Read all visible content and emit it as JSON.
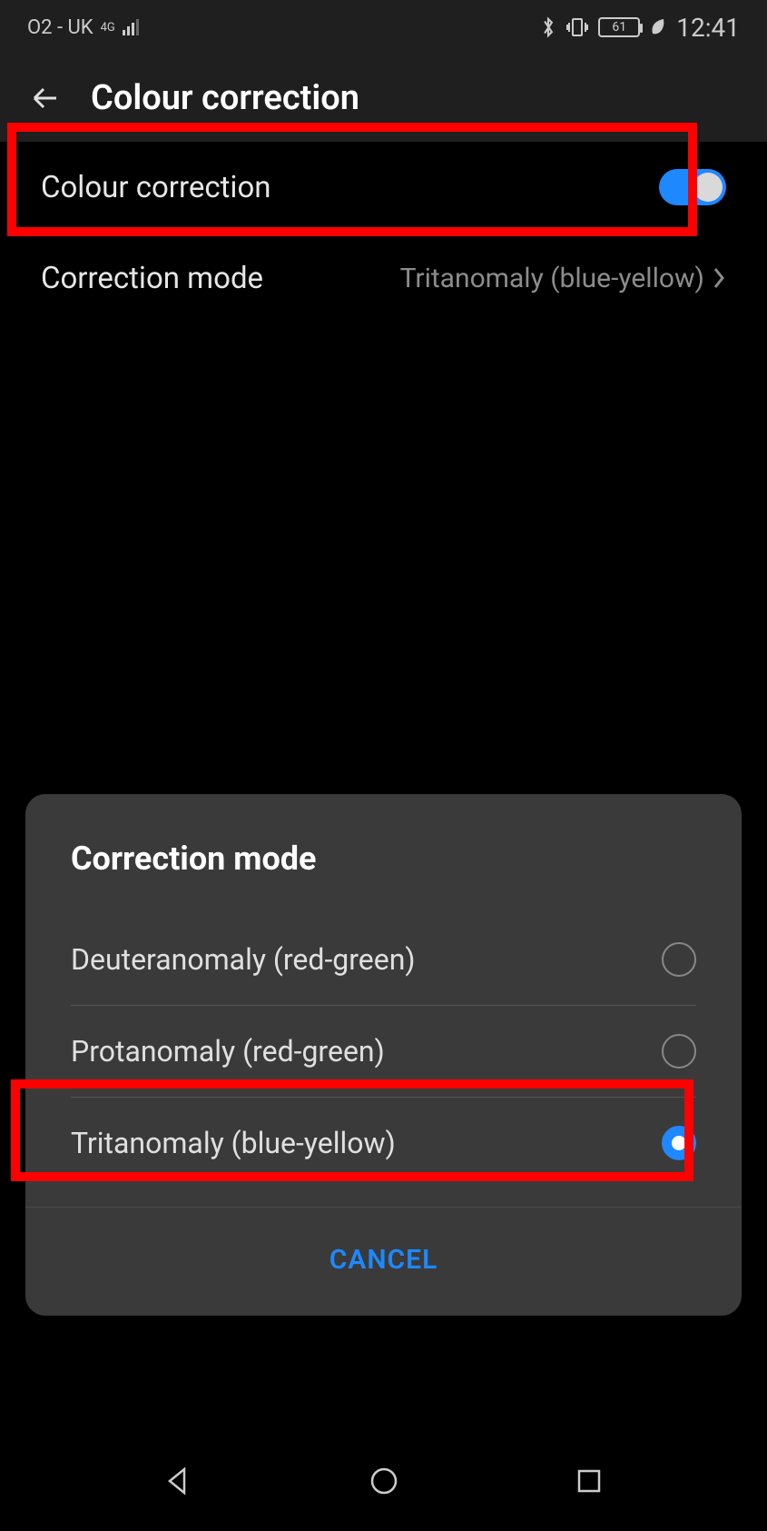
{
  "status_bar": {
    "carrier": "O2 - UK",
    "network_badge": "4G",
    "battery_pct": "61",
    "time": "12:41"
  },
  "header": {
    "title": "Colour correction"
  },
  "settings": {
    "toggle_label": "Colour correction",
    "toggle_on": true,
    "mode_label": "Correction mode",
    "mode_value": "Tritanomaly (blue-yellow)"
  },
  "dialog": {
    "title": "Correction mode",
    "options": [
      {
        "label": "Deuteranomaly (red-green)",
        "selected": false
      },
      {
        "label": "Protanomaly (red-green)",
        "selected": false
      },
      {
        "label": "Tritanomaly (blue-yellow)",
        "selected": true
      }
    ],
    "cancel": "CANCEL"
  },
  "colors": {
    "accent": "#1e88ff",
    "highlight": "#ff0000"
  }
}
